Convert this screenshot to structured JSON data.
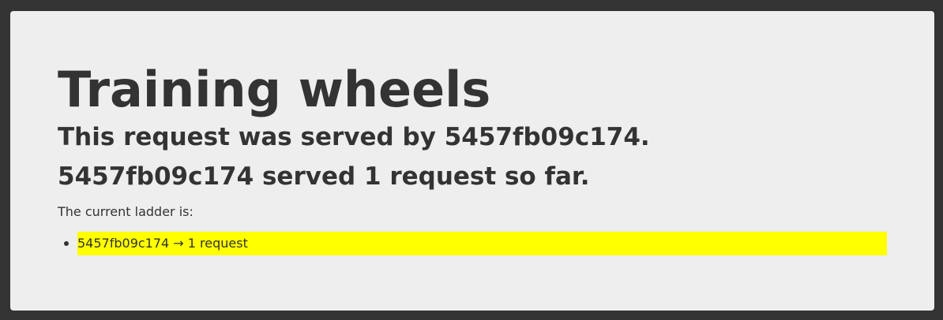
{
  "page": {
    "title": "Training wheels",
    "served_by_line": "This request was served by 5457fb09c174.",
    "count_line": "5457fb09c174 served 1 request so far.",
    "ladder_intro": "The current ladder is:"
  },
  "ladder": [
    {
      "text": "5457fb09c174 → 1 request",
      "highlight_color": "#ffff00"
    }
  ],
  "colors": {
    "outer_background": "#333333",
    "card_background": "#eeeeee",
    "text": "#333333",
    "highlight": "#ffff00"
  }
}
